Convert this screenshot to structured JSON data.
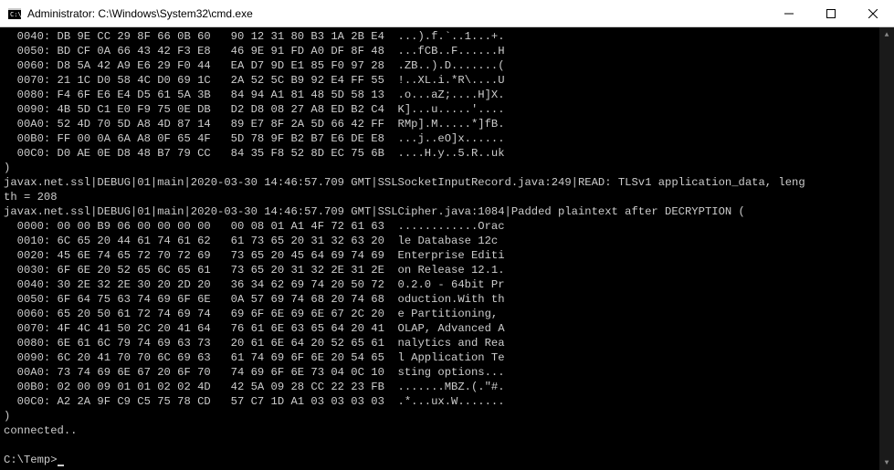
{
  "titlebar": {
    "title": "Administrator: C:\\Windows\\System32\\cmd.exe"
  },
  "hex1": [
    {
      "off": "0040",
      "h1": "DB 9E CC 29 8F 66 0B 60",
      "h2": "90 12 31 80 B3 1A 2B E4",
      "asc": "...).f.`..1...+."
    },
    {
      "off": "0050",
      "h1": "BD CF 0A 66 43 42 F3 E8",
      "h2": "46 9E 91 FD A0 DF 8F 48",
      "asc": "...fCB..F......H"
    },
    {
      "off": "0060",
      "h1": "D8 5A 42 A9 E6 29 F0 44",
      "h2": "EA D7 9D E1 85 F0 97 28",
      "asc": ".ZB..).D.......("
    },
    {
      "off": "0070",
      "h1": "21 1C D0 58 4C D0 69 1C",
      "h2": "2A 52 5C B9 92 E4 FF 55",
      "asc": "!..XL.i.*R\\....U"
    },
    {
      "off": "0080",
      "h1": "F4 6F E6 E4 D5 61 5A 3B",
      "h2": "84 94 A1 81 48 5D 58 13",
      "asc": ".o...aZ;....H]X."
    },
    {
      "off": "0090",
      "h1": "4B 5D C1 E0 F9 75 0E DB",
      "h2": "D2 D8 08 27 A8 ED B2 C4",
      "asc": "K]...u.....'...."
    },
    {
      "off": "00A0",
      "h1": "52 4D 70 5D A8 4D 87 14",
      "h2": "89 E7 8F 2A 5D 66 42 FF",
      "asc": "RMp].M.....*]fB."
    },
    {
      "off": "00B0",
      "h1": "FF 00 0A 6A A8 0F 65 4F",
      "h2": "5D 78 9F B2 B7 E6 DE E8",
      "asc": "...j..eO]x......"
    },
    {
      "off": "00C0",
      "h1": "D0 AE 0E D8 48 B7 79 CC",
      "h2": "84 35 F8 52 8D EC 75 6B",
      "asc": "....H.y..5.R..uk"
    }
  ],
  "close1": ")",
  "log1": "javax.net.ssl|DEBUG|01|main|2020-03-30 14:46:57.709 GMT|SSLSocketInputRecord.java:249|READ: TLSv1 application_data, leng",
  "log1b": "th = 208",
  "log2": "javax.net.ssl|DEBUG|01|main|2020-03-30 14:46:57.709 GMT|SSLCipher.java:1084|Padded plaintext after DECRYPTION (",
  "hex2": [
    {
      "off": "0000",
      "h1": "00 00 B9 06 00 00 00 00",
      "h2": "00 08 01 A1 4F 72 61 63",
      "asc": "............Orac"
    },
    {
      "off": "0010",
      "h1": "6C 65 20 44 61 74 61 62",
      "h2": "61 73 65 20 31 32 63 20",
      "asc": "le Database 12c "
    },
    {
      "off": "0020",
      "h1": "45 6E 74 65 72 70 72 69",
      "h2": "73 65 20 45 64 69 74 69",
      "asc": "Enterprise Editi"
    },
    {
      "off": "0030",
      "h1": "6F 6E 20 52 65 6C 65 61",
      "h2": "73 65 20 31 32 2E 31 2E",
      "asc": "on Release 12.1."
    },
    {
      "off": "0040",
      "h1": "30 2E 32 2E 30 20 2D 20",
      "h2": "36 34 62 69 74 20 50 72",
      "asc": "0.2.0 - 64bit Pr"
    },
    {
      "off": "0050",
      "h1": "6F 64 75 63 74 69 6F 6E",
      "h2": "0A 57 69 74 68 20 74 68",
      "asc": "oduction.With th"
    },
    {
      "off": "0060",
      "h1": "65 20 50 61 72 74 69 74",
      "h2": "69 6F 6E 69 6E 67 2C 20",
      "asc": "e Partitioning, "
    },
    {
      "off": "0070",
      "h1": "4F 4C 41 50 2C 20 41 64",
      "h2": "76 61 6E 63 65 64 20 41",
      "asc": "OLAP, Advanced A"
    },
    {
      "off": "0080",
      "h1": "6E 61 6C 79 74 69 63 73",
      "h2": "20 61 6E 64 20 52 65 61",
      "asc": "nalytics and Rea"
    },
    {
      "off": "0090",
      "h1": "6C 20 41 70 70 6C 69 63",
      "h2": "61 74 69 6F 6E 20 54 65",
      "asc": "l Application Te"
    },
    {
      "off": "00A0",
      "h1": "73 74 69 6E 67 20 6F 70",
      "h2": "74 69 6F 6E 73 04 0C 10",
      "asc": "sting options..."
    },
    {
      "off": "00B0",
      "h1": "02 00 09 01 01 02 02 4D",
      "h2": "42 5A 09 28 CC 22 23 FB",
      "asc": ".......MBZ.(.\"#."
    },
    {
      "off": "00C0",
      "h1": "A2 2A 9F C9 C5 75 78 CD",
      "h2": "57 C7 1D A1 03 03 03 03",
      "asc": ".*...ux.W......."
    }
  ],
  "close2": ")",
  "connected": "connected..",
  "blank": "",
  "prompt": "C:\\Temp>"
}
